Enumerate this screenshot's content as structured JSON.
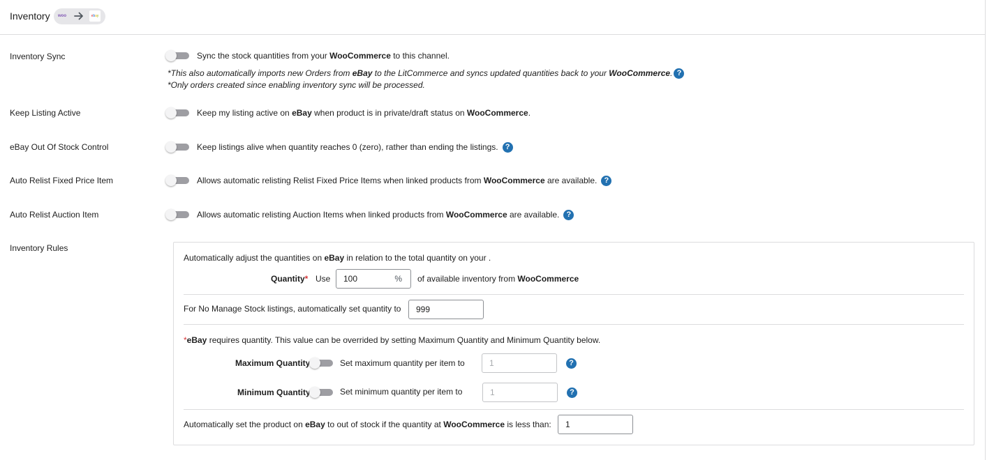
{
  "header": {
    "title": "Inventory",
    "woo_logo": "woo",
    "ebay_letters": [
      "e",
      "b",
      "a",
      "y"
    ]
  },
  "rows": {
    "sync": {
      "label": "Inventory Sync",
      "desc_pre": "Sync the stock quantities from your ",
      "desc_bold": "WooCommerce",
      "desc_post": " to this channel.",
      "note1_pre": "*This also automatically imports new Orders from ",
      "note1_b1": "eBay",
      "note1_mid": " to the LitCommerce and syncs updated quantities back to your ",
      "note1_b2": "WooCommerce",
      "note1_post": ".",
      "note2": "*Only orders created since enabling inventory sync will be processed."
    },
    "keep_active": {
      "label": "Keep Listing Active",
      "p1": "Keep my listing active on ",
      "b1": "eBay",
      "p2": " when product is in private/draft status on ",
      "b2": "WooCommerce",
      "p3": "."
    },
    "out_of_stock": {
      "label": "eBay Out Of Stock Control",
      "desc": "Keep listings alive when quantity reaches 0 (zero), rather than ending the listings."
    },
    "relist_fixed": {
      "label": "Auto Relist Fixed Price Item",
      "p1": "Allows automatic relisting Relist Fixed Price Items when linked products from ",
      "b1": "WooCommerce",
      "p2": " are available."
    },
    "relist_auction": {
      "label": "Auto Relist Auction Item",
      "p1": "Allows automatic relisting Auction Items when linked products from ",
      "b1": "WooCommerce",
      "p2": " are available."
    },
    "rules_label": "Inventory Rules"
  },
  "rules": {
    "intro_pre": "Automatically adjust the quantities on ",
    "intro_b": "eBay",
    "intro_post": " in relation to the total quantity on your .",
    "quantity_label": "Quantity",
    "required_mark": "*",
    "use_label": "Use",
    "quantity_value": "100",
    "percent_sign": "%",
    "of_available_pre": "of available inventory from ",
    "of_available_b": "WooCommerce",
    "no_manage_label": "For No Manage Stock listings, automatically set quantity to",
    "no_manage_value": "999",
    "requires_mark": "*",
    "requires_b": "eBay",
    "requires_post": " requires quantity. This value can be overrided by setting Maximum Quantity and Minimum Quantity below.",
    "max_label": "Maximum Quantity",
    "max_desc": "Set maximum quantity per item to",
    "max_value": "1",
    "min_label": "Minimum Quantity",
    "min_desc": "Set minimum quantity per item to",
    "min_value": "1",
    "oos_pre": "Automatically set the product on ",
    "oos_b1": "eBay",
    "oos_mid": " to out of stock if the quantity at ",
    "oos_b2": "WooCommerce",
    "oos_post": " is less than:",
    "oos_value": "1"
  },
  "help_glyph": "?",
  "colors": {
    "help": "#2271b1",
    "required": "#d63638",
    "toggle_off": "#9e9ea3"
  }
}
